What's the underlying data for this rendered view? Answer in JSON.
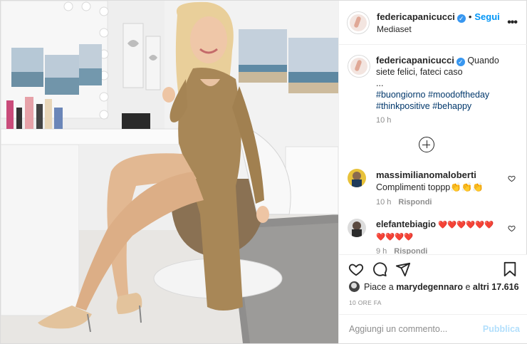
{
  "header": {
    "username": "federicapanicucci",
    "verified": "✓",
    "separator": "•",
    "follow_label": "Segui",
    "location": "Mediaset",
    "more_label": "•••"
  },
  "caption": {
    "username": "federicapanicucci",
    "verified": "✓",
    "text": "Quando siete felici, fateci caso",
    "ellipsis": "...",
    "hashtags": [
      "#buongiorno",
      "#moodoftheday",
      "#thinkpositive",
      "#behappy"
    ],
    "time": "10 h"
  },
  "comments": [
    {
      "username": "massimilianomaloberti",
      "text": "Complimenti toppp👏👏👏",
      "time": "10 h",
      "reply_label": "Rispondi"
    },
    {
      "username": "elefantebiagio",
      "text": "❤️❤️❤️❤️❤️❤️❤️❤️❤️❤️",
      "time": "9 h",
      "reply_label": "Rispondi"
    }
  ],
  "likes": {
    "prefix": "Piace a",
    "user": "marydegennaro",
    "connector": "e",
    "others": "altri 17.616"
  },
  "timestamp": "10 ORE FA",
  "add_comment": {
    "placeholder": "Aggiungi un commento...",
    "publish_label": "Pubblica"
  },
  "colors": {
    "link_blue": "#0095f6",
    "publish_disabled": "#b2dffc",
    "hashtag": "#00376b",
    "muted": "#8e8e8e"
  },
  "icons": [
    "heart-icon",
    "comment-icon",
    "share-icon",
    "bookmark-icon",
    "add-circle-icon",
    "more-options-icon"
  ]
}
